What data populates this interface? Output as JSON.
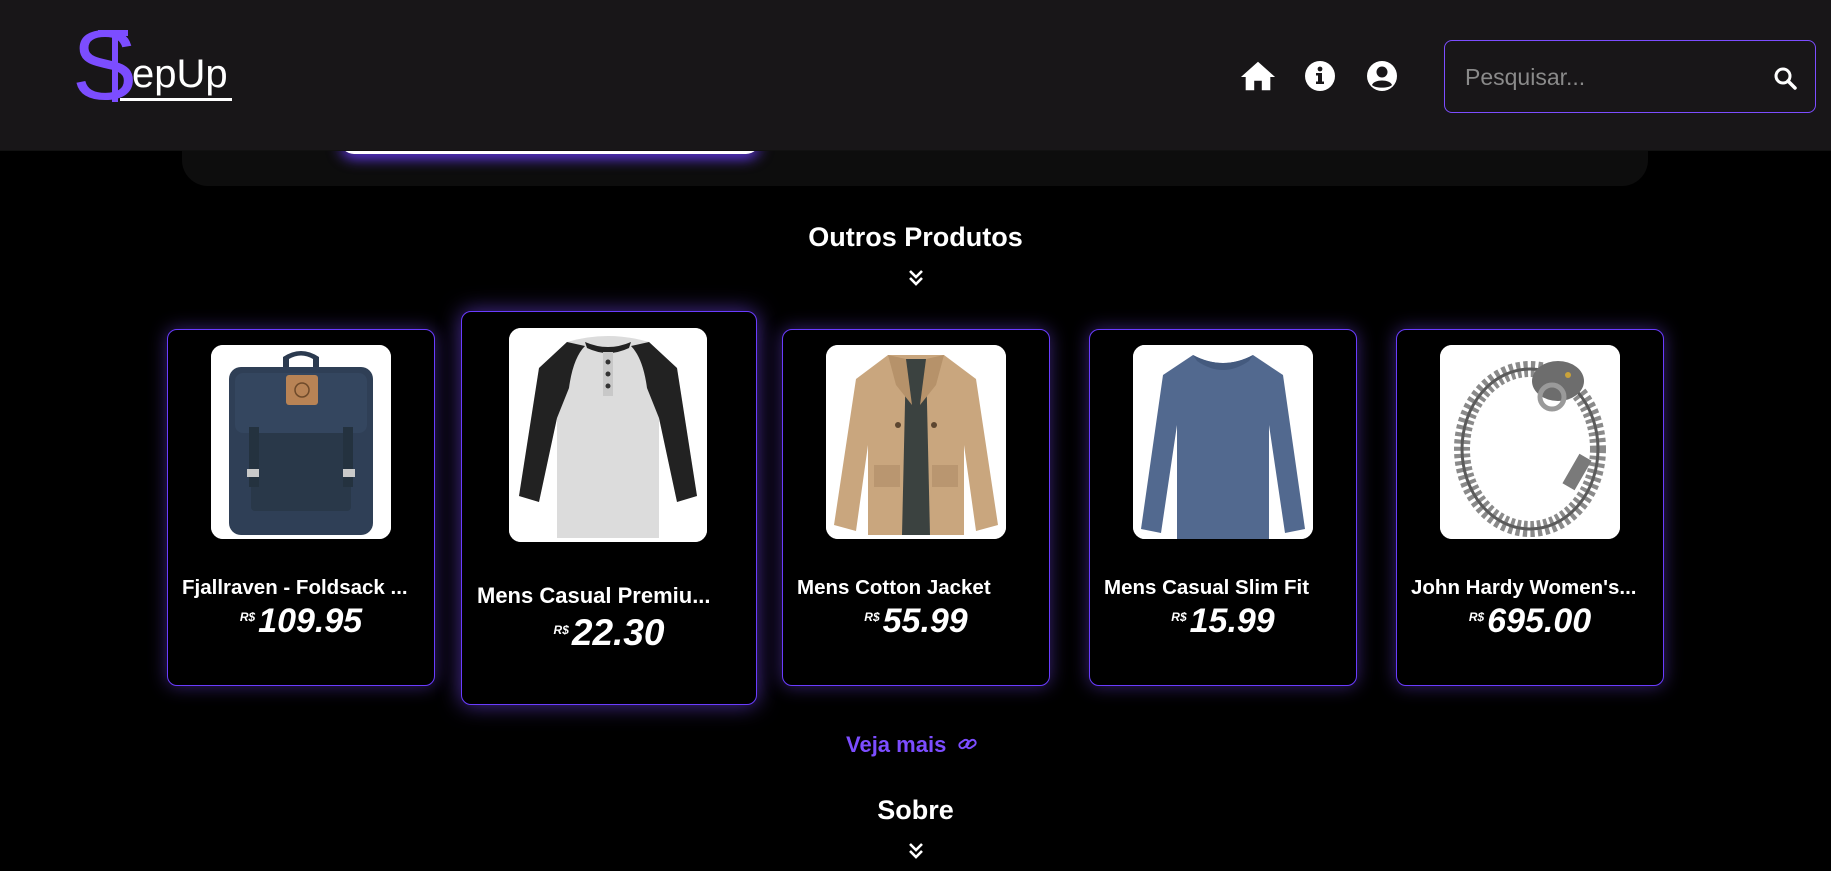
{
  "header": {
    "logo_first": "S",
    "logo_rest": "epUp",
    "nav": [
      {
        "icon": "home-icon"
      },
      {
        "icon": "info-icon"
      },
      {
        "icon": "user-circle-icon"
      }
    ],
    "search": {
      "placeholder": "Pesquisar...",
      "icon": "search-icon"
    }
  },
  "colors": {
    "accent": "#7c4dff",
    "header_bg": "#181618",
    "page_bg": "#000000"
  },
  "other_products": {
    "title": "Outros Produtos",
    "currency": "R$",
    "items": [
      {
        "name": "Fjallraven - Foldsack ...",
        "price": "109.95",
        "image": "backpack"
      },
      {
        "name": "Mens Casual Premiu...",
        "price": "22.30",
        "image": "raglan-shirt"
      },
      {
        "name": "Mens Cotton Jacket",
        "price": "55.99",
        "image": "jacket"
      },
      {
        "name": "Mens Casual Slim Fit",
        "price": "15.99",
        "image": "long-sleeve-shirt"
      },
      {
        "name": "John Hardy Women's...",
        "price": "695.00",
        "image": "bracelet"
      }
    ],
    "see_more": "Veja mais"
  },
  "about": {
    "title": "Sobre"
  }
}
